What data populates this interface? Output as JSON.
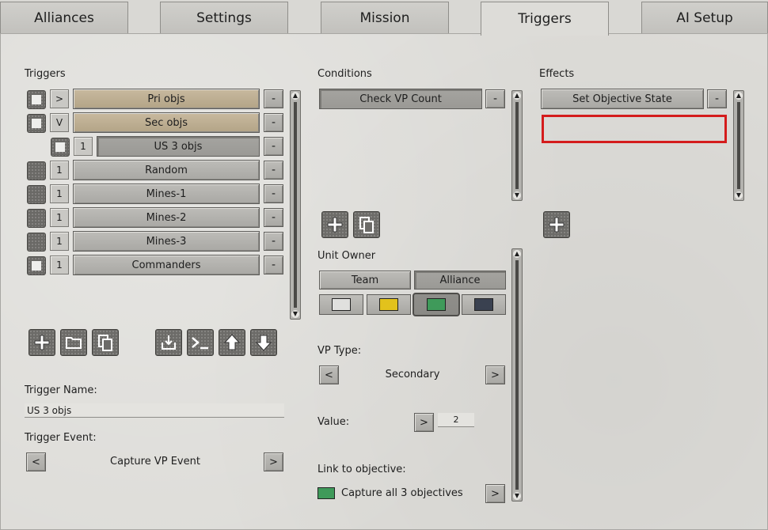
{
  "tabs": [
    "Alliances",
    "Settings",
    "Mission",
    "Triggers",
    "AI Setup"
  ],
  "triggers": {
    "heading": "Triggers",
    "rows": [
      {
        "toggle": ">",
        "name": "Pri objs"
      },
      {
        "toggle": "V",
        "name": "Sec objs"
      },
      {
        "toggle": "1",
        "name": "US 3 objs"
      },
      {
        "toggle": "1",
        "name": "Random"
      },
      {
        "toggle": "1",
        "name": "Mines-1"
      },
      {
        "toggle": "1",
        "name": "Mines-2"
      },
      {
        "toggle": "1",
        "name": "Mines-3"
      },
      {
        "toggle": "1",
        "name": "Commanders"
      }
    ],
    "remove_label": "-",
    "name_label": "Trigger Name:",
    "name_value": "US 3 objs",
    "event_label": "Trigger Event:",
    "event_value": "Capture VP Event",
    "prev": "<",
    "next": ">"
  },
  "conditions": {
    "heading": "Conditions",
    "items": [
      "Check VP Count"
    ],
    "remove_label": "-",
    "unit_owner_label": "Unit Owner",
    "team_label": "Team",
    "alliance_label": "Alliance",
    "colors": [
      "#e0e0de",
      "#e2c21c",
      "#3f9a5a",
      "#3a4150"
    ],
    "vp_type_label": "VP Type:",
    "vp_type_value": "Secondary",
    "value_label": "Value:",
    "value": "2",
    "link_label": "Link to objective:",
    "link_value": "Capture all 3 objectives",
    "link_color": "#3f9a5a",
    "prev": "<",
    "next": ">"
  },
  "effects": {
    "heading": "Effects",
    "items": [
      "Set Objective State"
    ],
    "remove_label": "-",
    "highlight_color": "#d41c1c"
  }
}
